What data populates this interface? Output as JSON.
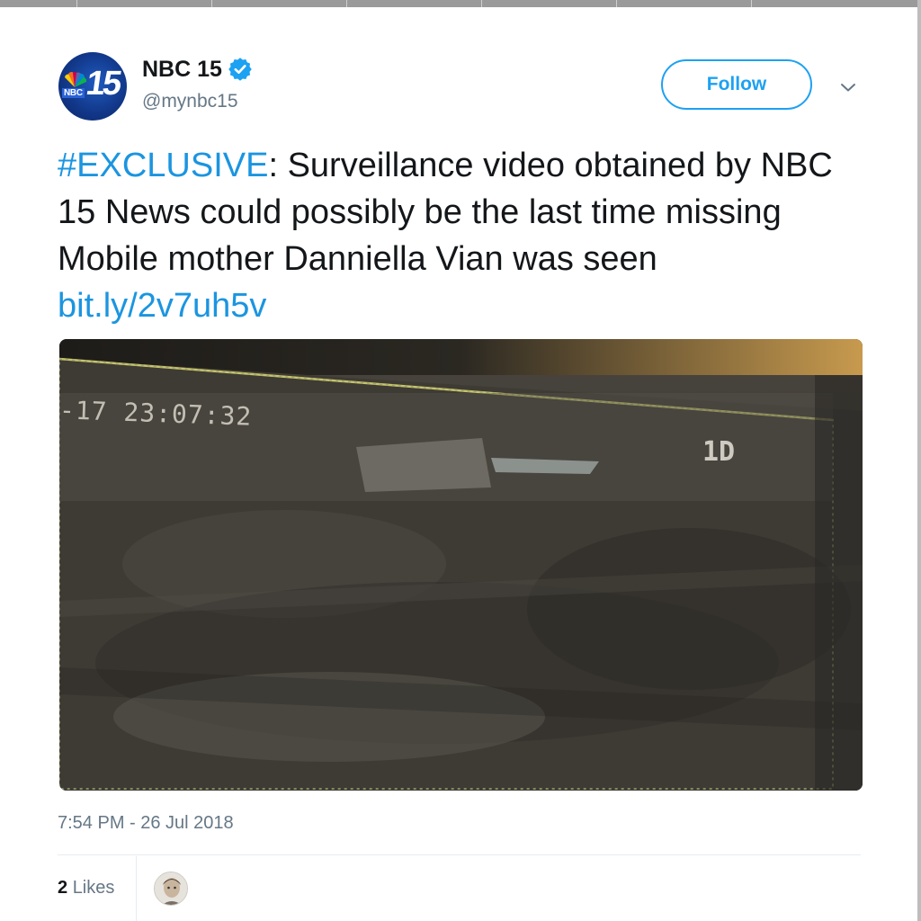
{
  "account": {
    "name": "NBC 15",
    "handle": "@mynbc15",
    "avatar_text": "15",
    "avatar_badge": "NBC",
    "verified": true
  },
  "follow_label": "Follow",
  "tweet": {
    "hashtag": "#EXCLUSIVE",
    "body": ":  Surveillance video obtained by NBC 15 News could possibly be the last time missing Mobile mother Danniella Vian was seen ",
    "link": "bit.ly/2v7uh5v"
  },
  "media": {
    "overlay_timestamp": "-17 23:07:32",
    "overlay_label": "1D"
  },
  "timestamp": "7:54 PM - 26 Jul 2018",
  "likes": {
    "count": "2",
    "label": "Likes"
  },
  "icons": {
    "verified": "verified-badge-icon",
    "caret": "chevron-down-icon"
  },
  "colors": {
    "link": "#1b95e0",
    "follow": "#1da1f2",
    "muted": "#657786",
    "text": "#14171a"
  }
}
